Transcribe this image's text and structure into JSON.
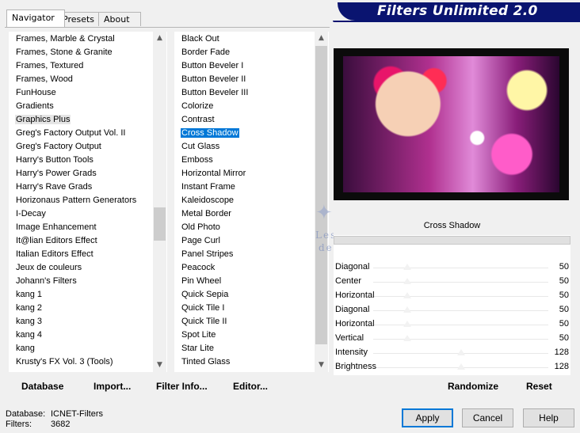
{
  "tabs": [
    {
      "label": "Navigator",
      "active": true
    },
    {
      "label": "Presets",
      "active": false
    },
    {
      "label": "About",
      "active": false
    }
  ],
  "title": "Filters Unlimited 2.0",
  "categories": [
    "Frames, Marble & Crystal",
    "Frames, Stone & Granite",
    "Frames, Textured",
    "Frames, Wood",
    "FunHouse",
    "Gradients",
    "Graphics Plus",
    "Greg's Factory Output Vol. II",
    "Greg's Factory Output",
    "Harry's Button Tools",
    "Harry's Power Grads",
    "Harry's Rave Grads",
    "Horizonaus Pattern Generators",
    "I-Decay",
    "Image Enhancement",
    "It@lian Editors Effect",
    "Italian Editors Effect",
    "Jeux de couleurs",
    "Johann's Filters",
    "kang 1",
    "kang 2",
    "kang 3",
    "kang 4",
    "kang",
    "Krusty's FX Vol. 3 (Tools)"
  ],
  "selected_category": "Graphics Plus",
  "filters": [
    "Black Out",
    "Border Fade",
    "Button Beveler I",
    "Button Beveler II",
    "Button Beveler III",
    "Colorize",
    "Contrast",
    "Cross Shadow",
    "Cut Glass",
    "Emboss",
    "Horizontal Mirror",
    "Instant Frame",
    "Kaleidoscope",
    "Metal Border",
    "Old Photo",
    "Page Curl",
    "Panel Stripes",
    "Peacock",
    "Pin Wheel",
    "Quick Sepia",
    "Quick Tile I",
    "Quick Tile II",
    "Spot Lite",
    "Star Lite",
    "Tinted Glass"
  ],
  "selected_filter": "Cross Shadow",
  "filter_title": "Cross Shadow",
  "params": [
    {
      "label": "Diagonal",
      "value": 50,
      "fraction": 0.196
    },
    {
      "label": "Center",
      "value": 50,
      "fraction": 0.196
    },
    {
      "label": "Horizontal",
      "value": 50,
      "fraction": 0.196
    },
    {
      "label": "Diagonal",
      "value": 50,
      "fraction": 0.196
    },
    {
      "label": "Horizontal",
      "value": 50,
      "fraction": 0.196
    },
    {
      "label": "Vertical",
      "value": 50,
      "fraction": 0.196
    },
    {
      "label": "Intensity",
      "value": 128,
      "fraction": 0.5
    },
    {
      "label": "Brightness",
      "value": 128,
      "fraction": 0.5
    }
  ],
  "left_buttons": {
    "database": "Database",
    "import": "Import...",
    "filter_info": "Filter Info...",
    "editor": "Editor..."
  },
  "right_buttons": {
    "randomize": "Randomize",
    "reset": "Reset"
  },
  "footer": {
    "database_label": "Database:",
    "database_value": "ICNET-Filters",
    "filters_label": "Filters:",
    "filters_value": "3682"
  },
  "dialog_buttons": {
    "apply": "Apply",
    "cancel": "Cancel",
    "help": "Help"
  },
  "watermark": {
    "line1": "Les Tutoriels",
    "line2": "de Violine©"
  }
}
